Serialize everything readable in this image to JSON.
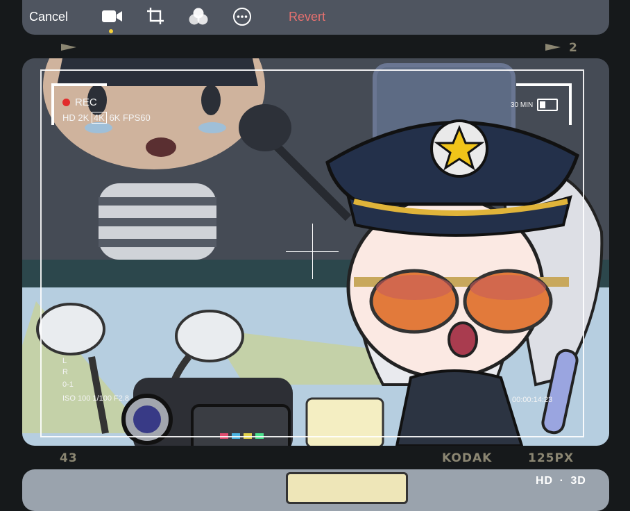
{
  "toolbar": {
    "cancel_label": "Cancel",
    "revert_label": "Revert",
    "icons": [
      "video-icon",
      "crop-icon",
      "filters-icon",
      "more-icon"
    ],
    "active_icon": "video-icon"
  },
  "film_strip": {
    "top_frame_number": "2",
    "bottom_frame_number": "43",
    "brand": "KODAK",
    "film_speed": "125PX"
  },
  "viewfinder": {
    "rec_label": "REC",
    "resolution_prefix": "HD 2K",
    "resolution_selected": "4K",
    "resolution_suffix": "6K FPS60",
    "battery_text": "30 MIN",
    "timecode": "00:00:14:23",
    "exposure_line1": "L",
    "exposure_line2": "R",
    "exposure_line3": "0-1",
    "exposure_line4": "ISO 100 1/100  F2.8",
    "hd_label": "HD",
    "separator": "·",
    "three_d_label": "3D"
  },
  "colors": {
    "revert": "#e6716f",
    "active_dot": "#f3cf3a",
    "rec_dot": "#e22c2c",
    "strip_label": "#8b8672"
  }
}
